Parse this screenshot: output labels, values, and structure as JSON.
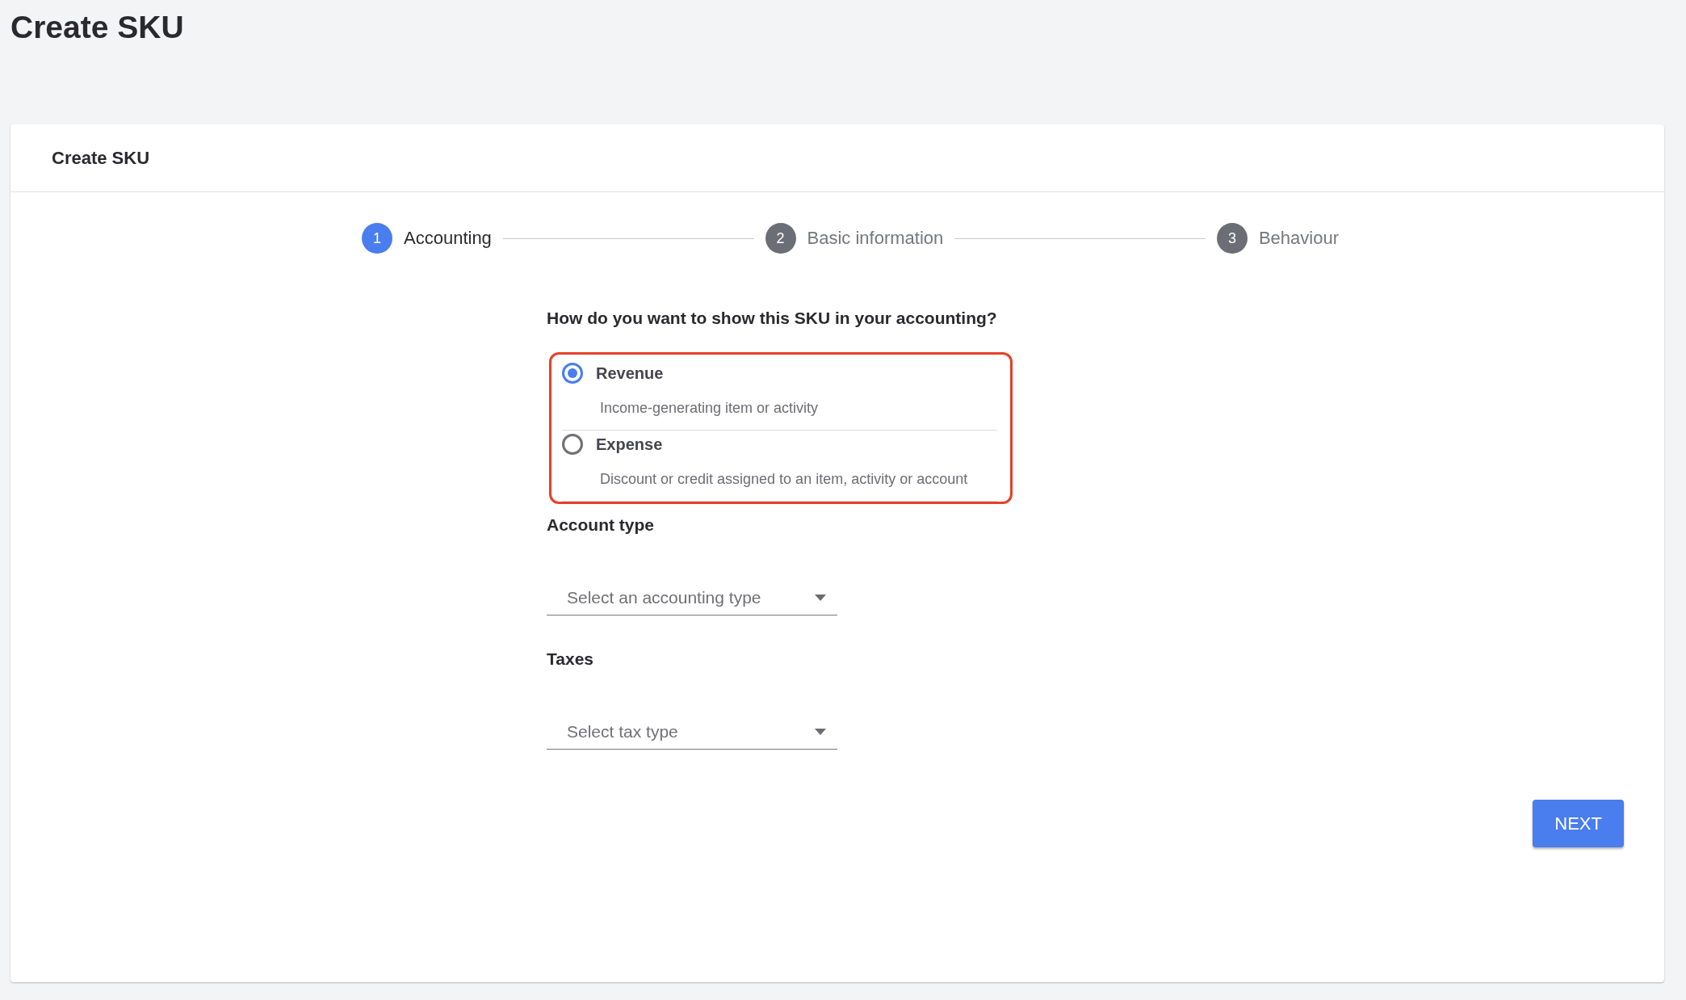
{
  "page_title": "Create SKU",
  "card": {
    "title": "Create SKU",
    "steps": [
      {
        "number": "1",
        "label": "Accounting",
        "selected": true
      },
      {
        "number": "2",
        "label": "Basic information",
        "selected": false
      },
      {
        "number": "3",
        "label": "Behaviour",
        "selected": false
      }
    ],
    "question": "How do you want to show this SKU in your accounting?",
    "options": [
      {
        "label": "Revenue",
        "description": "Income-generating item or activity",
        "selected": true
      },
      {
        "label": "Expense",
        "description": "Discount or credit assigned to an item, activity or account",
        "selected": false
      }
    ],
    "fields": [
      {
        "label": "Account type",
        "placeholder": "Select an accounting type"
      },
      {
        "label": "Taxes",
        "placeholder": "Select tax type"
      }
    ],
    "next_button": "NEXT"
  }
}
